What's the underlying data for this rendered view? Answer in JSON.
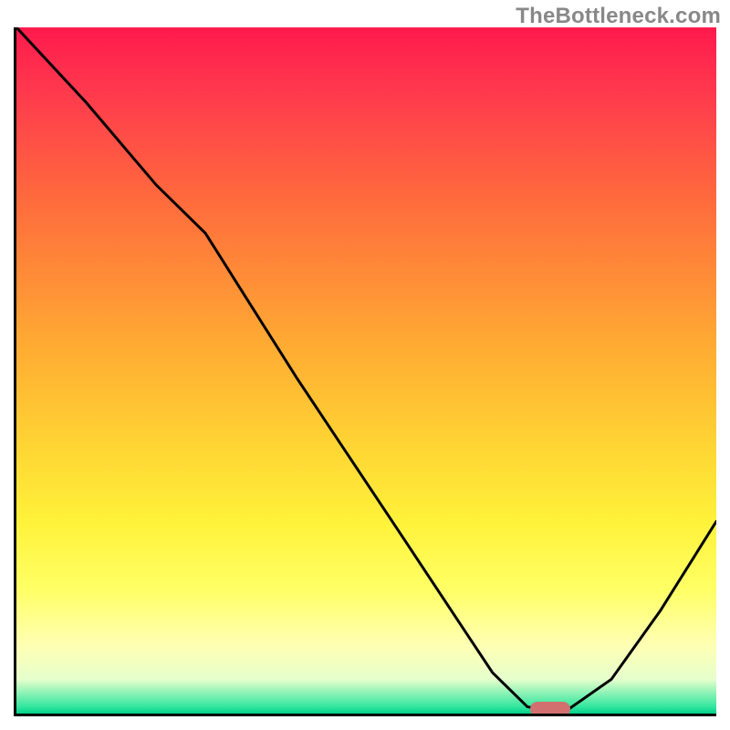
{
  "watermark": "TheBottleneck.com",
  "colors": {
    "curve_stroke": "#000000",
    "marker_fill": "#d27070",
    "axis": "#000000"
  },
  "chart_data": {
    "type": "line",
    "title": "",
    "xlabel": "",
    "ylabel": "",
    "xlim": [
      0,
      100
    ],
    "ylim": [
      0,
      100
    ],
    "grid": false,
    "series": [
      {
        "name": "bottleneck-curve",
        "x": [
          0,
          10,
          20,
          27,
          40,
          55,
          68,
          73,
          78,
          85,
          92,
          100
        ],
        "y": [
          100,
          89,
          77,
          70,
          49,
          26,
          6,
          1,
          0,
          5,
          15,
          28
        ]
      }
    ],
    "marker": {
      "x": 76,
      "y": 1
    }
  }
}
